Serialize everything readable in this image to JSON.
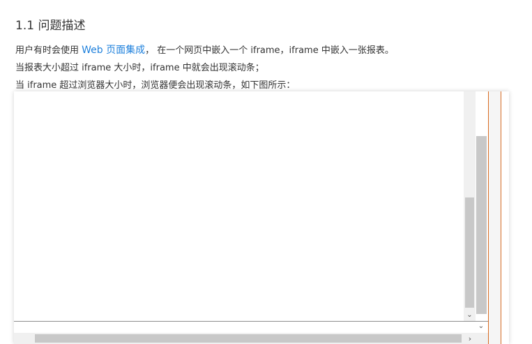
{
  "article": {
    "heading": "1.1 问题描述",
    "p1_before": "用户有时会使用 ",
    "p1_link": "Web 页面集成",
    "p1_after": "， 在一个网页中嵌入一个 iframe，iframe 中嵌入一张报表。",
    "p2": "当报表大小超过 iframe 大小时，iframe 中就会出现滚动条；",
    "p3": "当 iframe 超过浏览器大小时，浏览器便会出现滚动条，如下图所示："
  },
  "screenshot": {
    "inner_scroll_down_glyph": "⌄",
    "outer_scroll_down_glyph": "⌄",
    "outer_scroll_right_glyph": "›",
    "border_accent_color": "#d96a20",
    "link_color": "#1e80dc"
  }
}
